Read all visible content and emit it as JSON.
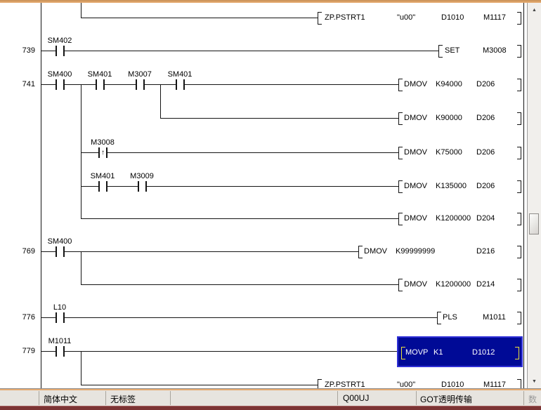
{
  "colors": {
    "selection_bg": "#000a96",
    "selection_border": "#2f2fd6",
    "selection_bracket": "#ece23c",
    "accent_strip": "#e5ab72",
    "bottom_bar": "#7c3434",
    "wire": "#141414"
  },
  "icons": {
    "rising_edge": "↑",
    "scroll_up": "▲",
    "scroll_down": "▼"
  },
  "rows": [
    {
      "instr": {
        "opcode": "ZP.PSTRT1",
        "op1": "\"u00\"",
        "op2": "D1010",
        "op3": "M1117"
      }
    },
    {
      "number": "739",
      "contacts": [
        {
          "label": "SM402"
        }
      ],
      "instr": {
        "opcode": "SET",
        "op1": "M3008"
      }
    },
    {
      "number": "741",
      "contacts": [
        {
          "label": "SM400"
        },
        {
          "label": "SM401"
        },
        {
          "label": "M3007"
        },
        {
          "label": "SM401"
        }
      ],
      "instr": {
        "opcode": "DMOV",
        "op1": "K94000",
        "op2": "D206"
      }
    },
    {
      "instr": {
        "opcode": "DMOV",
        "op1": "K90000",
        "op2": "D206"
      }
    },
    {
      "contacts": [
        {
          "label": "M3008",
          "edge": true
        }
      ],
      "instr": {
        "opcode": "DMOV",
        "op1": "K75000",
        "op2": "D206"
      }
    },
    {
      "contacts": [
        {
          "label": "SM401"
        },
        {
          "label": "M3009"
        }
      ],
      "instr": {
        "opcode": "DMOV",
        "op1": "K135000",
        "op2": "D206"
      }
    },
    {
      "instr": {
        "opcode": "DMOV",
        "op1": "K1200000",
        "op2": "D204"
      }
    },
    {
      "number": "769",
      "contacts": [
        {
          "label": "SM400"
        }
      ],
      "instr": {
        "opcode": "DMOV",
        "op1": "K99999999",
        "op2": "D216"
      }
    },
    {
      "instr": {
        "opcode": "DMOV",
        "op1": "K1200000",
        "op2": "D214"
      }
    },
    {
      "number": "776",
      "contacts": [
        {
          "label": "L10"
        }
      ],
      "instr": {
        "opcode": "PLS",
        "op1": "M1011"
      }
    },
    {
      "number": "779",
      "contacts": [
        {
          "label": "M1011"
        }
      ],
      "selected": true,
      "instr": {
        "opcode": "MOVP",
        "op1": "K1",
        "op2": "D1012"
      }
    },
    {
      "instr": {
        "opcode": "ZP.PSTRT1",
        "op1": "\"u00\"",
        "op2": "D1010",
        "op3": "M1117"
      }
    }
  ],
  "statusbar": {
    "lang": "简体中文",
    "label_state": "无标签",
    "cpu": "Q00UJ",
    "connection": "GOT透明传输",
    "right_text": "数"
  }
}
